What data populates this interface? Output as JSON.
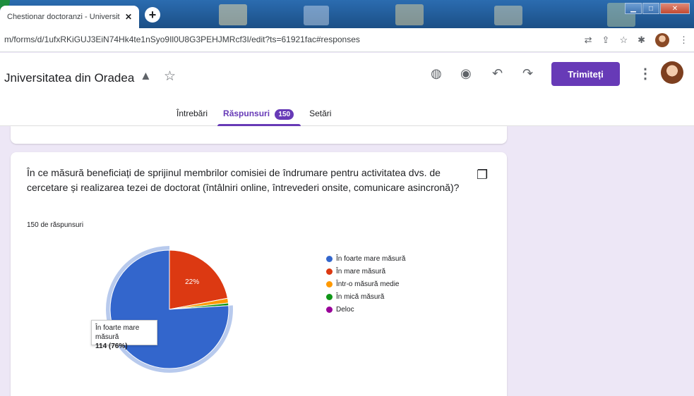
{
  "browser": {
    "tab_title": "Chestionar doctoranzi - Universit",
    "tab_close": "✕",
    "new_tab": "+",
    "url": "m/forms/d/1ufxRKiGUJ3EiN74Hk4te1nSyo9Il0U8G3PEHJMRcf3I/edit?ts=61921fac#responses"
  },
  "form_header": {
    "title": "Jniversitatea din Oradea",
    "send_label": "Trimiteți",
    "tabs": [
      {
        "label": "Întrebări"
      },
      {
        "label": "Răspunsuri",
        "badge": "150"
      },
      {
        "label": "Setări"
      }
    ]
  },
  "question_card": {
    "question": "În ce măsură beneficiați de sprijinul membrilor comisiei de îndrumare pentru activitatea dvs. de cercetare și realizarea tezei de doctorat (întâlniri online, întrevederi onsite, comunicare asincronă)?",
    "responses_count": "150 de răspunsuri",
    "tooltip": {
      "label": "În foarte mare măsură",
      "value": "114 (76%)"
    }
  },
  "chart_data": {
    "type": "pie",
    "slices": [
      {
        "label": "În foarte mare măsură",
        "percent": 76,
        "count": 114,
        "color": "#3366cc"
      },
      {
        "label": "În mare măsură",
        "percent": 22,
        "color": "#dc3912"
      },
      {
        "label": "Într-o măsură medie",
        "percent": 1.3,
        "color": "#ff9900"
      },
      {
        "label": "În mică măsură",
        "percent": 0.7,
        "color": "#109618"
      },
      {
        "label": "Deloc",
        "percent": 0,
        "color": "#990099"
      }
    ],
    "data_labels": [
      "22%"
    ],
    "highlighted_slice": "În foarte mare măsură",
    "legend_placement": "right"
  }
}
